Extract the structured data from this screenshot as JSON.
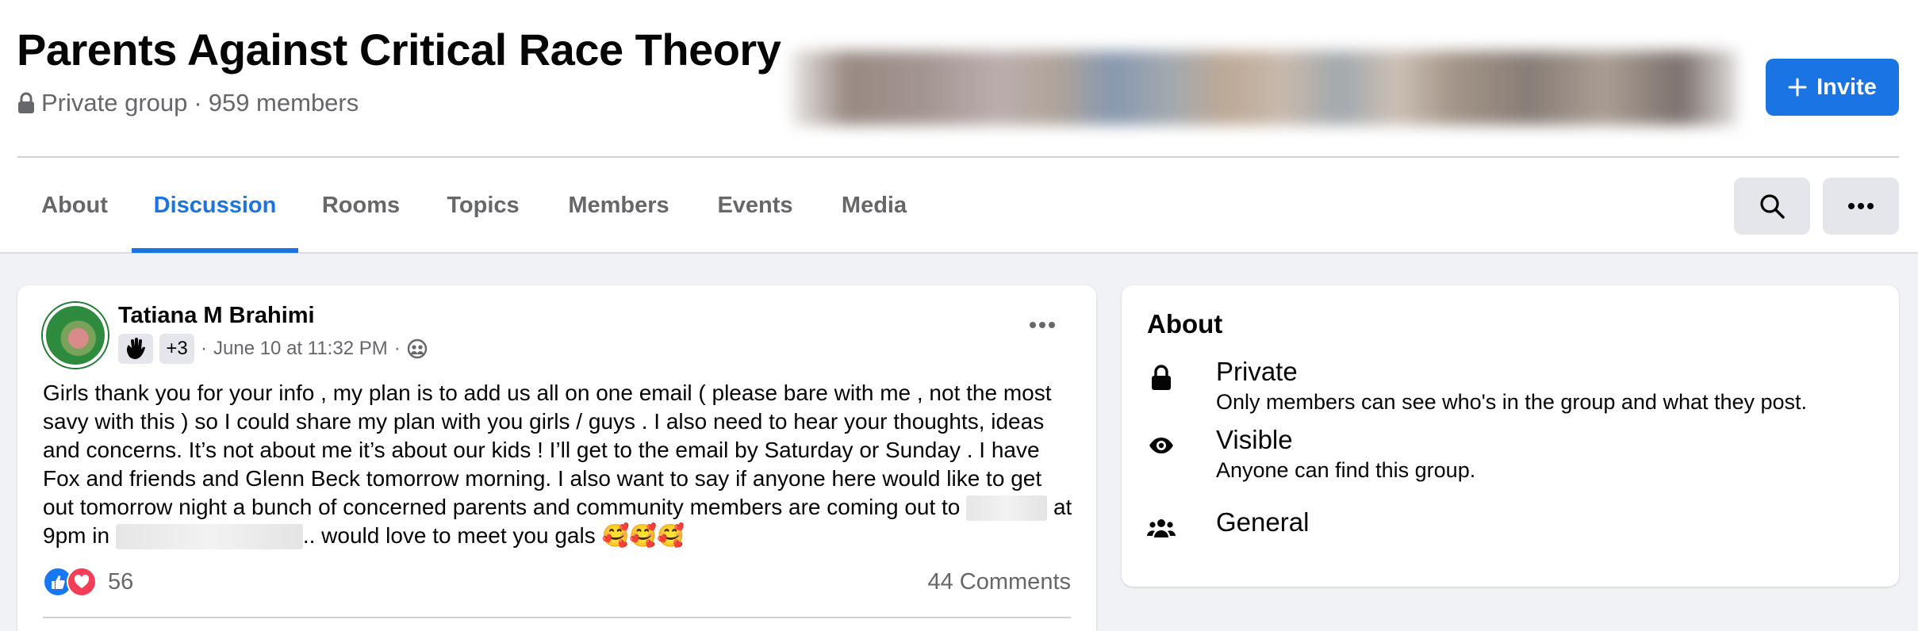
{
  "group": {
    "name": "Parents Against Critical Race Theory",
    "privacy": "Private group",
    "separator": "·",
    "members": "959 members",
    "invite_label": "Invite"
  },
  "tabs": [
    {
      "label": "About",
      "active": false
    },
    {
      "label": "Discussion",
      "active": true
    },
    {
      "label": "Rooms",
      "active": false
    },
    {
      "label": "Topics",
      "active": false
    },
    {
      "label": "Members",
      "active": false
    },
    {
      "label": "Events",
      "active": false
    },
    {
      "label": "Media",
      "active": false
    }
  ],
  "toolbar_icons": [
    "search-icon",
    "more-icon"
  ],
  "post": {
    "author": "Tatiana M Brahimi",
    "badge_extra": "+3",
    "date": "June 10 at 11:32 PM",
    "dot": "·",
    "audience_icon": "group-audience-icon",
    "text_part1": "Girls thank you for your info , my plan is to add us all on one email ( please bare with me , not the most savy with this ) so I could share my plan with you girls / guys . I also need to hear your thoughts, ideas and concerns. It’s not about me it’s about our kids ! I’ll get to the email by Saturday or Sunday . I have Fox and friends and Glenn Beck tomorrow morning. I also want to say if anyone here would like to get out tomorrow night a bunch of concerned parents and community members are coming out to",
    "text_part2": "at 9pm in",
    "text_part3": ".. would love to meet you gals 🥰🥰🥰",
    "reaction_count": "56",
    "comments": "44 Comments",
    "reaction_icons": [
      "like-icon",
      "love-icon"
    ],
    "colors": {
      "like": "#1877f2",
      "love": "#f33e58"
    }
  },
  "about": {
    "title": "About",
    "items": [
      {
        "icon": "lock-icon",
        "title": "Private",
        "desc": "Only members can see who's in the group and what they post."
      },
      {
        "icon": "eye-icon",
        "title": "Visible",
        "desc": "Anyone can find this group."
      },
      {
        "icon": "people-icon",
        "title": "General",
        "desc": ""
      }
    ]
  },
  "colors": {
    "accent": "#1b74e4",
    "background": "#f0f2f5",
    "secondary_text": "#65676b"
  }
}
